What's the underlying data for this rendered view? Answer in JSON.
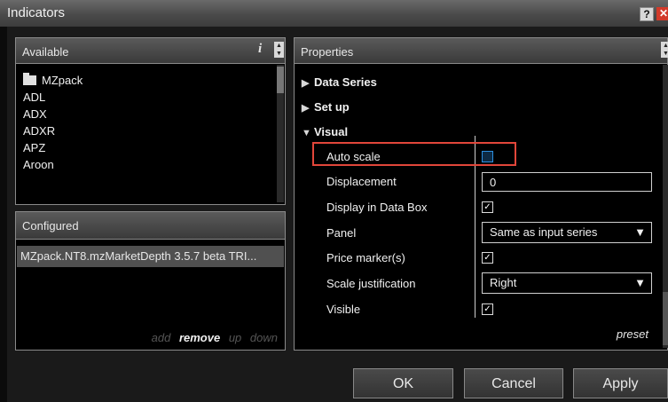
{
  "window": {
    "title": "Indicators",
    "help_label": "?",
    "close_label": "✕"
  },
  "available": {
    "header": "Available",
    "info_label": "i",
    "items": [
      {
        "label": "MZpack",
        "icon": "folder-icon"
      },
      {
        "label": "ADL"
      },
      {
        "label": "ADX"
      },
      {
        "label": "ADXR"
      },
      {
        "label": "APZ"
      },
      {
        "label": "Aroon"
      }
    ]
  },
  "configured": {
    "header": "Configured",
    "items": [
      "MZpack.NT8.mzMarketDepth 3.5.7 beta TRI..."
    ],
    "actions": {
      "add": "add",
      "remove": "remove",
      "up": "up",
      "down": "down"
    }
  },
  "properties": {
    "header": "Properties",
    "sections": {
      "data_series": "Data Series",
      "set_up": "Set up",
      "visual": "Visual"
    },
    "rows": {
      "auto_scale": {
        "label": "Auto scale",
        "checked": false
      },
      "displacement": {
        "label": "Displacement",
        "value": "0"
      },
      "display_in_data_box": {
        "label": "Display in Data Box",
        "checked": true
      },
      "panel": {
        "label": "Panel",
        "value": "Same as input series"
      },
      "price_markers": {
        "label": "Price marker(s)",
        "checked": true
      },
      "scale_justification": {
        "label": "Scale justification",
        "value": "Right"
      },
      "visible": {
        "label": "Visible",
        "checked": true
      }
    },
    "preset_label": "preset"
  },
  "buttons": {
    "ok": "OK",
    "cancel": "Cancel",
    "apply": "Apply"
  },
  "colors": {
    "highlight": "#e2463a",
    "autoscale_checkbox": "#2c8fe0"
  }
}
